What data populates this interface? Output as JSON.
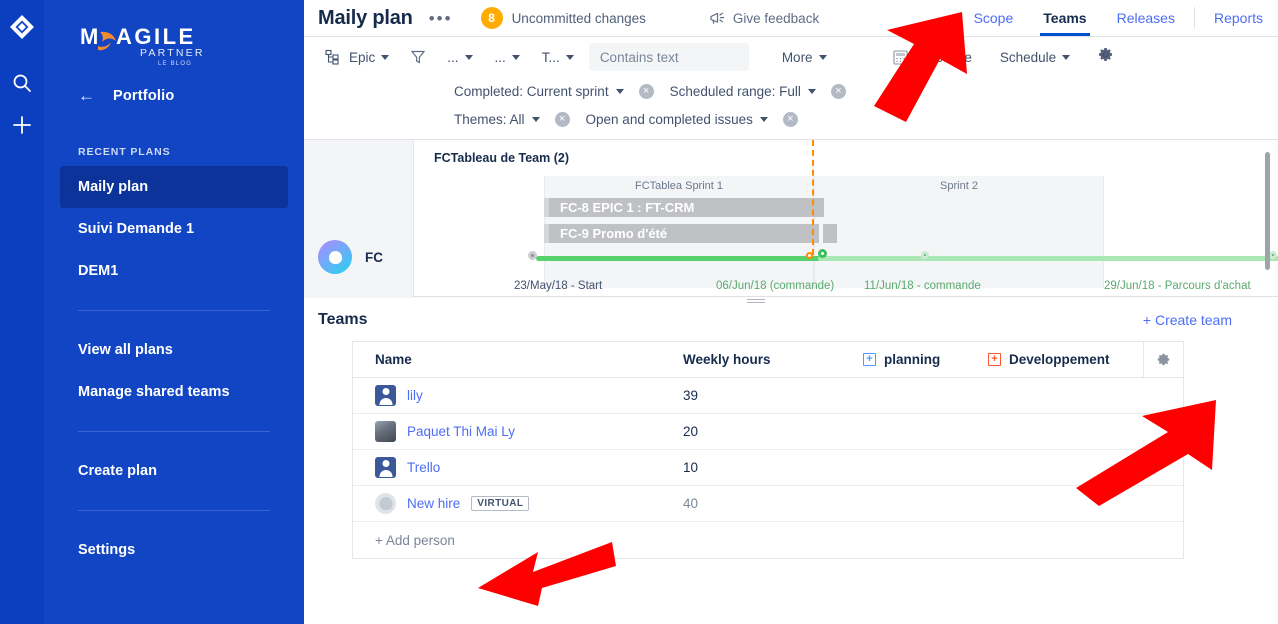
{
  "rail": {
    "logo_icon": "jira-portfolio-diamond-logo",
    "search_icon": "search-icon",
    "add_icon": "plus-icon"
  },
  "sidebar": {
    "back_icon": "back-arrow-icon",
    "portfolio_label": "Portfolio",
    "section_label": "RECENT PLANS",
    "recent_plans": [
      {
        "label": "Maily plan",
        "active": true
      },
      {
        "label": "Suivi Demande 1",
        "active": false
      },
      {
        "label": "DEM1",
        "active": false
      }
    ],
    "links": [
      {
        "label": "View all plans"
      },
      {
        "label": "Manage shared teams"
      },
      {
        "label": "Create plan"
      },
      {
        "label": "Settings"
      }
    ]
  },
  "header": {
    "plan_title": "Maily plan",
    "more_dots": "•••",
    "uncommitted_count": "8",
    "uncommitted_label": "Uncommitted changes",
    "feedback_label": "Give feedback",
    "feedback_icon": "megaphone-icon",
    "tabs": [
      {
        "label": "Scope",
        "active": false
      },
      {
        "label": "Teams",
        "active": true
      },
      {
        "label": "Releases",
        "active": false
      },
      {
        "label": "Reports",
        "active": false
      }
    ]
  },
  "toolbar": {
    "hierarchy_icon": "hierarchy-icon",
    "hierarchy_label": "Epic",
    "filter_icon": "filter-funnel-icon",
    "filter_1": "...",
    "filter_2": "...",
    "filter_3": "T...",
    "contains_placeholder": "Contains text",
    "more_label": "More",
    "calculate_label": "Calculate",
    "calculate_icon": "calculator-icon",
    "schedule_label": "Schedule",
    "settings_icon": "gear-icon",
    "chips": [
      {
        "label": "Completed: Current sprint"
      },
      {
        "label": "Scheduled range: Full"
      },
      {
        "label": "Themes: All"
      },
      {
        "label": "Open and completed issues"
      }
    ]
  },
  "timeline": {
    "team_avatar_icon": "team-avatar-icon",
    "team_label": "FC",
    "board_title": "FCTableau de Team (2)",
    "sprints": [
      {
        "label": "FCTablea Sprint 1"
      },
      {
        "label": "Sprint 2"
      }
    ],
    "bars": [
      {
        "label": "FC-8 EPIC 1 : FT-CRM"
      },
      {
        "label": "FC-9 Promo d'été"
      }
    ],
    "markers": [
      {
        "label": "23/May/18 - Start",
        "color": "gray"
      },
      {
        "label": "06/Jun/18 (commande)",
        "color": "green"
      },
      {
        "label": "11/Jun/18 - commande",
        "color": "green"
      },
      {
        "label": "29/Jun/18 - Parcours d'achat",
        "color": "green"
      }
    ]
  },
  "teams": {
    "title": "Teams",
    "create_team_label": "+ Create team",
    "columns": [
      {
        "label": "Name",
        "icon": null
      },
      {
        "label": "Weekly hours",
        "icon": null
      },
      {
        "label": "planning",
        "icon": "plus-box-blue-icon"
      },
      {
        "label": "Developpement",
        "icon": "plus-box-red-icon"
      }
    ],
    "settings_icon": "gear-icon",
    "rows": [
      {
        "name": "lily",
        "avatar": "avatar-default-blue",
        "hours": "39",
        "virtual": false
      },
      {
        "name": "Paquet Thi Mai Ly",
        "avatar": "avatar-photo",
        "hours": "20",
        "virtual": false
      },
      {
        "name": "Trello",
        "avatar": "avatar-default-blue",
        "hours": "10",
        "virtual": false
      },
      {
        "name": "New hire",
        "avatar": "avatar-ghost",
        "hours": "40",
        "virtual": true,
        "virtual_label": "VIRTUAL"
      }
    ],
    "add_person_label": "+ Add person"
  },
  "annotations": {
    "arrow_color": "#FF0000",
    "arrows": [
      {
        "name": "arrow-to-teams-tab"
      },
      {
        "name": "arrow-to-table-settings"
      },
      {
        "name": "arrow-to-add-person"
      }
    ]
  },
  "colors": {
    "sidebar_bg": "#1245c4",
    "rail_bg": "#0b3fbf",
    "active_nav": "#0c3399",
    "link_blue": "#4c6ef5",
    "text_dark": "#172b4d",
    "badge_orange": "#ffab00",
    "timeline_green": "#57d16c",
    "today_orange": "#ff8b00"
  }
}
